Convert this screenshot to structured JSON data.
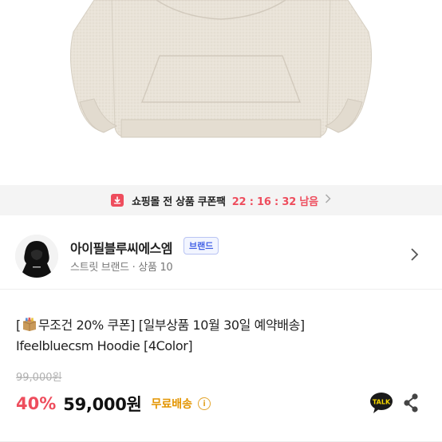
{
  "product_image": {
    "alt_icon": "hoodie-photo"
  },
  "coupon_banner": {
    "label": "쇼핑몰 전 상품 쿠폰팩",
    "timer": "22 : 16 : 32 남음",
    "icon": "coupon-icon",
    "accent_color": "#ee4d5d"
  },
  "shop": {
    "name": "아이필블루씨에스엠",
    "badge": "브랜드",
    "meta": "스트릿 브랜드 · 상품 10",
    "avatar_icon": "shop-avatar"
  },
  "product": {
    "title_line1_open": "[",
    "title_line1_rest": "무조건 20% 쿠폰] [일부상품 10월 30일 예약배송]",
    "title_line2": "Ifeelbluecsm Hoodie [4Color]",
    "original_price": "99,000원",
    "discount": "40%",
    "price": "59,000원",
    "shipping": "무료배송",
    "info_glyph": "i"
  },
  "actions": {
    "talk_label": "TALK",
    "share_icon": "share-icon"
  },
  "colors": {
    "discount": "#ee4d5d",
    "shipping": "#e39500",
    "badge_text": "#4563e6"
  }
}
